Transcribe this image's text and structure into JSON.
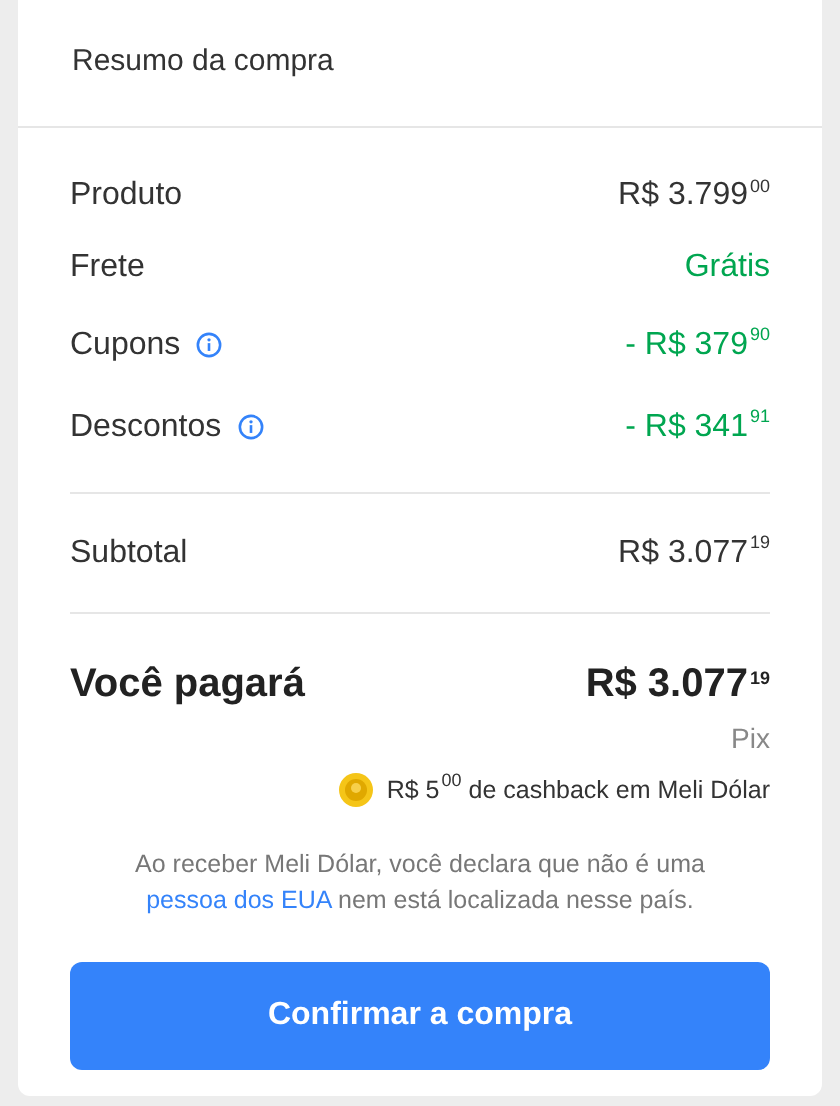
{
  "title": "Resumo da compra",
  "rows": [
    {
      "label": "Produto",
      "value": "R$ 3.799$^{00}$",
      "kind": "normal",
      "info": false
    },
    {
      "label": "Frete",
      "value": "Grátis",
      "kind": "positive",
      "info": false
    },
    {
      "label": "Cupons",
      "value": "- R$ 379$^{90}$",
      "kind": "positive",
      "info": true
    },
    {
      "label": "Descontos",
      "value": "- R$ 341$^{91}$",
      "kind": "positive",
      "info": true
    }
  ],
  "subtotal": {
    "label": "Subtotal",
    "value": "R$ 3.077$^{19}$"
  },
  "total": {
    "label": "Você pagará",
    "value": "R$ 3.077$^{19}$",
    "method": "Pix"
  },
  "cashback": "R$ 5$^{00}$ de cashback em Meli Dólar",
  "disclaimer": {
    "before": "Ao receber Meli Dólar, você declara que não é uma",
    "link": "pessoa dos EUA",
    "after": "nem está localizada nesse país."
  },
  "button": "Confirmar a compra"
}
